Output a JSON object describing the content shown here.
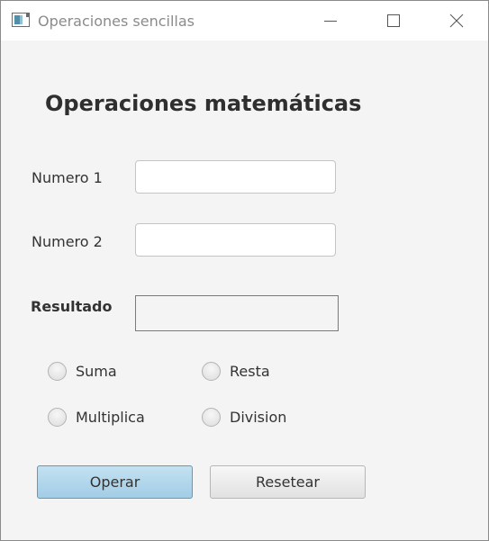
{
  "window": {
    "title": "Operaciones sencillas",
    "icon": "app-window-icon",
    "controls": [
      "minimize-icon",
      "maximize-icon",
      "close-icon"
    ]
  },
  "form": {
    "heading": "Operaciones matemáticas",
    "numero1": {
      "label": "Numero 1",
      "value": "",
      "placeholder": ""
    },
    "numero2": {
      "label": "Numero 2",
      "value": "",
      "placeholder": ""
    },
    "resultado": {
      "label": "Resultado",
      "value": ""
    },
    "operations": {
      "suma": "Suma",
      "resta": "Resta",
      "multiplica": "Multiplica",
      "division": "Division"
    },
    "buttons": {
      "operar": "Operar",
      "resetear": "Resetear"
    }
  },
  "colors": {
    "primary_button": "#a9d2e9",
    "primary_button_border": "#5b9bc4",
    "window_background": "#f4f4f4"
  }
}
